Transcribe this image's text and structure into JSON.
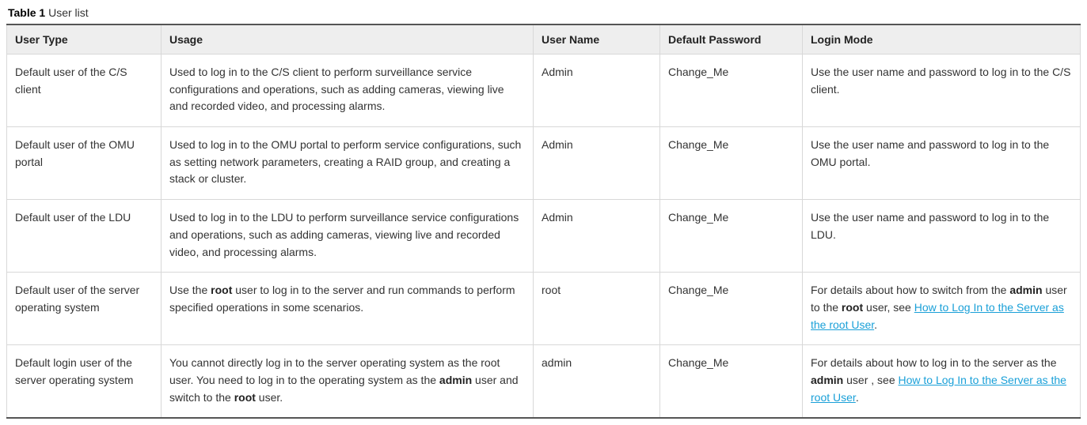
{
  "caption_prefix": "Table 1",
  "caption_text": "User list",
  "headers": {
    "user_type": "User Type",
    "usage": "Usage",
    "user_name": "User Name",
    "default_password": "Default Password",
    "login_mode": "Login Mode"
  },
  "rows": {
    "r0": {
      "user_type": "Default user of the C/S client",
      "usage": "Used to log in to the C/S client to perform surveillance service configurations and operations, such as adding cameras, viewing live and recorded video, and processing alarms.",
      "user_name": "Admin",
      "default_password": "Change_Me",
      "login_mode": "Use the user name and password to log in to the C/S client."
    },
    "r1": {
      "user_type": "Default user of the OMU portal",
      "usage": "Used to log in to the OMU portal to perform service configurations, such as setting network parameters, creating a RAID group, and creating a stack or cluster.",
      "user_name": "Admin",
      "default_password": "Change_Me",
      "login_mode": "Use the user name and password to log in to the OMU portal."
    },
    "r2": {
      "user_type": "Default user of the LDU",
      "usage": "Used to log in to the LDU to perform surveillance service configurations and operations, such as adding cameras, viewing live and recorded video, and processing alarms.",
      "user_name": "Admin",
      "default_password": "Change_Me",
      "login_mode": "Use the user name and password to log in to the LDU."
    },
    "r3": {
      "user_type": "Default user of the server operating system",
      "usage_pre": "Use the ",
      "usage_b1": "root",
      "usage_post": " user to log in to the server and run commands to perform specified operations in some scenarios.",
      "user_name": "root",
      "default_password": "Change_Me",
      "login_pre": "For details about how to switch from the ",
      "login_b1": "admin",
      "login_mid": " user to the ",
      "login_b2": "root",
      "login_post": " user, see ",
      "login_link": "How to Log In to the Server as the root User",
      "login_end": "."
    },
    "r4": {
      "user_type": "Default login user of the server operating system",
      "usage_pre": "You cannot directly log in to the server operating system as the root user. You need to log in to the operating system as the ",
      "usage_b1": "admin",
      "usage_mid": " user and switch to the ",
      "usage_b2": "root",
      "usage_post": " user.",
      "user_name": "admin",
      "default_password": "Change_Me",
      "login_pre": "For details about how to log in to the server as the ",
      "login_b1": "admin",
      "login_mid": " user , see ",
      "login_link": "How to Log In to the Server as the root User",
      "login_end": "."
    }
  }
}
